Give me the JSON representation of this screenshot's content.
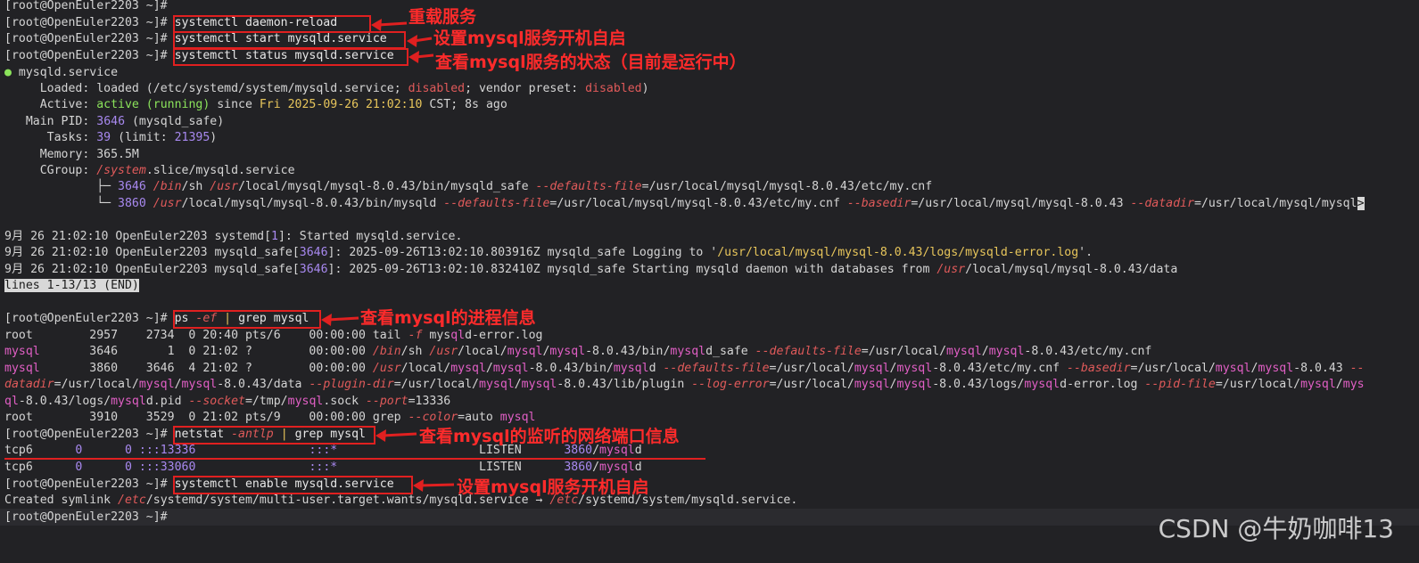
{
  "prompt": "[root@OpenEuler2203 ~]# ",
  "commands": {
    "c1": "systemctl daemon-reload",
    "c2": "systemctl start mysqld.service",
    "c3": "systemctl status mysqld.service",
    "c4": "ps -ef | grep mysql",
    "c5": "netstat -antlp | grep mysql",
    "c6": "systemctl enable mysqld.service"
  },
  "annotations": {
    "a1": "重载服务",
    "a2": "设置mysql服务开机自启",
    "a3": "查看mysql服务的状态（目前是运行中）",
    "a4": "查看mysql的进程信息",
    "a5": "查看mysql的监听的网络端口信息",
    "a6": "设置mysql服务开机自启"
  },
  "status": {
    "unit": "mysqld.service",
    "loaded_label": "Loaded:",
    "loaded_pre": "loaded (/etc/systemd/system/mysqld.service; ",
    "loaded_disabled": "disabled",
    "loaded_mid": "; vendor preset: ",
    "loaded_disabled2": "disabled",
    "loaded_post": ")",
    "active_label": "Active:",
    "active_state": "active (running)",
    "active_since": " since ",
    "active_date": "Fri 2025-09-26 21:02:10",
    "active_tail": " CST; 8s ago",
    "pid_label": "Main PID:",
    "pid_val": "3646",
    "pid_name": " (mysqld_safe)",
    "tasks_label": "Tasks:",
    "tasks_val": "39",
    "tasks_limit_a": " (limit: ",
    "tasks_limit": "21395",
    "tasks_limit_b": ")",
    "mem_label": "Memory:",
    "mem_val": "365.5M",
    "cg_label": "CGroup:",
    "cg_val_a": "/system",
    "cg_val_b": ".slice/mysqld.service"
  },
  "cgroup": {
    "p1_pid": "3646",
    "p1_bin": "/bin",
    "p1_a": "/sh ",
    "p1_usr": "/usr",
    "p1_b": "/local/mysql/mysql-8.0.43/bin/mysqld_safe ",
    "p1_opt": "--defaults-file",
    "p1_c": "=/usr/local/mysql/mysql-8.0.43/etc/my.cnf",
    "p2_pid": "3860",
    "p2_usr": "/usr",
    "p2_a": "/local/mysql/mysql-8.0.43/bin/mysqld ",
    "p2_opt1": "--defaults-file",
    "p2_b": "=/usr/local/mysql/mysql-8.0.43/etc/my.cnf ",
    "p2_opt2": "--basedir",
    "p2_c": "=/usr/local/mysql/mysql-8.0.43 ",
    "p2_opt3": "--datadir",
    "p2_d": "=/usr/local/mysql/mysql",
    "p2_end": ">"
  },
  "journal": {
    "j1_a": "9月 26 21:02:10 OpenEuler2203 systemd[",
    "j1_n": "1",
    "j1_b": "]: Started mysqld.service.",
    "j2_a": "9月 26 21:02:10 OpenEuler2203 mysqld_safe[",
    "j2_n": "3646",
    "j2_b": "]: 2025-09-26T13:02:10.803916Z mysqld_safe Logging to '",
    "j2_path": "/usr/local/mysql/mysql-8.0.43/logs/mysqld-error.log",
    "j2_c": "'.",
    "j3_a": "9月 26 21:02:10 OpenEuler2203 mysqld_safe[",
    "j3_n": "3646",
    "j3_b": "]: 2025-09-26T13:02:10.832410Z mysqld_safe Starting mysqld daemon with databases from ",
    "j3_usr": "/usr",
    "j3_c": "/local/mysql/mysql-8.0.43/data",
    "pager": "lines 1-13/13 (END)"
  },
  "ps": {
    "r1": "root        2957    2734  0 20:40 pts/6    00:00:00 tail ",
    "r1_opt": "-f",
    "r1_a": " mys",
    "r1_b": "ql",
    "r1_c": "d-error.log",
    "r2_user": "mysql",
    "r2_a": "       3646       1  0 21:02 ?        00:00:00 ",
    "r2_bin": "/bin",
    "r2_b": "/sh ",
    "r2_usr": "/usr",
    "r2_c": "/local/",
    "r2_m1": "mysql",
    "r2_d": "/",
    "r2_m2": "mysql",
    "r2_e": "-8.0.43/bin/",
    "r2_m3": "mysql",
    "r2_f": "d_safe ",
    "r2_opt": "--defaults-file",
    "r2_g": "=/usr/local/",
    "r2_m4": "mysql",
    "r2_h": "/",
    "r2_m5": "mysql",
    "r2_i": "-8.0.43/etc/my.cnf",
    "r3_user": "mysql",
    "r3_a": "       3860    3646  4 21:02 ?        00:00:00 ",
    "r3_usr": "/usr",
    "r3_b": "/local/",
    "r3_m1": "mysql",
    "r3_c": "/",
    "r3_m2": "mysql",
    "r3_d": "-8.0.43/bin/",
    "r3_m3": "mysql",
    "r3_e": "d ",
    "r3_opt1": "--defaults-file",
    "r3_f": "=/usr/local/",
    "r3_m4": "mysql",
    "r3_g": "/",
    "r3_m5": "mysql",
    "r3_h": "-8.0.43/etc/my.cnf ",
    "r3_opt2": "--basedir",
    "r3_i": "=/usr/local/",
    "r3_m6": "mysql",
    "r3_j": "/",
    "r3_m7": "mysql",
    "r3_k": "-8.0.43 ",
    "r3_dd": "--",
    "r4_a": "datadir",
    "r4_b": "=/usr/local/",
    "r4_m1": "mysql",
    "r4_c": "/",
    "r4_m2": "mysql",
    "r4_d": "-8.0.43/data ",
    "r4_opt1": "--plugin-dir",
    "r4_e": "=/usr/local/",
    "r4_m3": "mysql",
    "r4_f": "/",
    "r4_m4": "mysql",
    "r4_g": "-8.0.43/lib/plugin ",
    "r4_opt2": "--log-error",
    "r4_h": "=/usr/local/",
    "r4_m5": "mysql",
    "r4_i": "/",
    "r4_m6": "mysql",
    "r4_j": "-8.0.43/logs/",
    "r4_m7": "mysql",
    "r4_k": "d-error.log ",
    "r4_opt3": "--pid-file",
    "r4_l": "=/usr/local/",
    "r4_m8": "mysql",
    "r4_m": "/",
    "r4_m9": "mys",
    "r5_m0": "ql",
    "r5_a": "-8.0.43/logs/",
    "r5_m1": "mysql",
    "r5_b": "d.pid ",
    "r5_opt1": "--socket",
    "r5_c": "=/tmp/",
    "r5_m2": "mysql",
    "r5_d": ".sock ",
    "r5_opt2": "--port",
    "r5_e": "=13336",
    "r6_a": "root        3910    3529  0 21:02 pts/9    00:00:00 grep ",
    "r6_opt": "--color",
    "r6_b": "=auto ",
    "r6_m": "mysql"
  },
  "netstat": {
    "n1_proto": "tcp6",
    "n1_q": "0      0",
    "n1_local": ":::13336",
    "n1_foreign": ":::*",
    "n1_state": "LISTEN",
    "n1_pid": "3860",
    "n1_slash": "/",
    "n1_prog": "mysql",
    "n1_d": "d",
    "n2_proto": "tcp6",
    "n2_q": "0      0",
    "n2_local": ":::33060",
    "n2_foreign": ":::*",
    "n2_state": "LISTEN",
    "n2_pid": "3860",
    "n2_slash": "/",
    "n2_prog": "mysql",
    "n2_d": "d"
  },
  "symlink": {
    "a": "Created symlink ",
    "p1": "/etc",
    "b": "/systemd/system/multi-user.target.wants/mysqld.service → ",
    "p2": "/etc",
    "c": "/systemd/system/mysqld.service."
  },
  "watermark": "CSDN @牛奶咖啡13",
  "colors": {
    "annotation": "#ff2b2b",
    "background": "#222225",
    "green": "#8be35b",
    "red": "#e05a5a",
    "purple": "#a889f0",
    "yellow": "#e7c55b",
    "magenta": "#e15fc5"
  }
}
